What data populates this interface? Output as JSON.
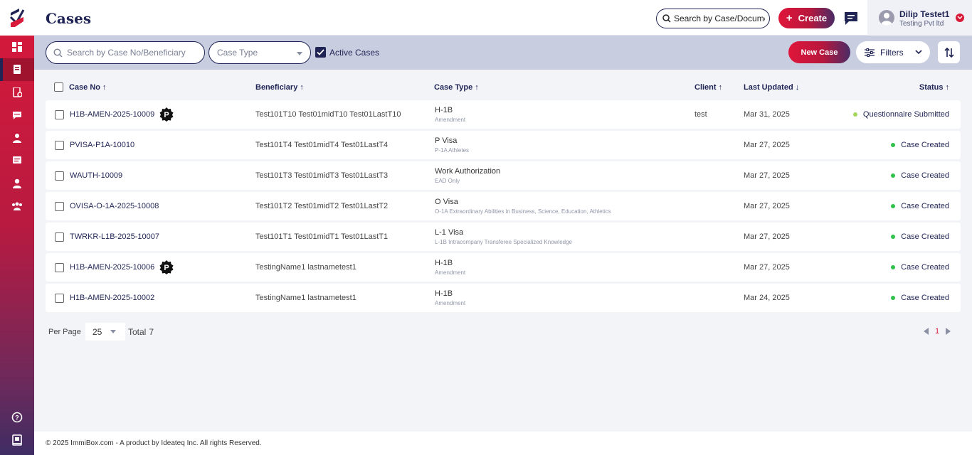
{
  "header": {
    "title": "Cases",
    "global_search_placeholder": "Search by Case/Document",
    "create_label": "Create",
    "user_name": "Dilip Testet1",
    "user_org": "Testing Pvt ltd"
  },
  "toolbar": {
    "search_placeholder": "Search by Case No/Beneficiary",
    "case_type_placeholder": "Case Type",
    "active_cases_label": "Active Cases",
    "active_cases_checked": true,
    "new_case_label": "New Case",
    "filters_label": "Filters"
  },
  "table": {
    "columns": [
      "Case No",
      "Beneficiary",
      "Case Type",
      "Client",
      "Last Updated",
      "Status"
    ],
    "rows": [
      {
        "case_no": "H1B-AMEN-2025-10009",
        "badge": "P",
        "beneficiary": "Test101T10 Test01midT10 Test01LastT10",
        "case_type": "H-1B",
        "case_subtype": "Amendment",
        "client": "test",
        "last_updated": "Mar 31, 2025",
        "status": "Questionnaire Submitted",
        "status_color": "#a4d65e"
      },
      {
        "case_no": "PVISA-P1A-10010",
        "badge": "",
        "beneficiary": "Test101T4 Test01midT4 Test01LastT4",
        "case_type": "P Visa",
        "case_subtype": "P-1A Athletes",
        "client": "",
        "last_updated": "Mar 27, 2025",
        "status": "Case Created",
        "status_color": "#2ec24a"
      },
      {
        "case_no": "WAUTH-10009",
        "badge": "",
        "beneficiary": "Test101T3 Test01midT3 Test01LastT3",
        "case_type": "Work Authorization",
        "case_subtype": "EAD Only",
        "client": "",
        "last_updated": "Mar 27, 2025",
        "status": "Case Created",
        "status_color": "#2ec24a"
      },
      {
        "case_no": "OVISA-O-1A-2025-10008",
        "badge": "",
        "beneficiary": "Test101T2 Test01midT2 Test01LastT2",
        "case_type": "O Visa",
        "case_subtype": "O-1A Extraordinary Abilities in Business, Science, Education, Athletics",
        "client": "",
        "last_updated": "Mar 27, 2025",
        "status": "Case Created",
        "status_color": "#2ec24a"
      },
      {
        "case_no": "TWRKR-L1B-2025-10007",
        "badge": "",
        "beneficiary": "Test101T1 Test01midT1 Test01LastT1",
        "case_type": "L-1 Visa",
        "case_subtype": "L-1B Intracompany Transferee Specialized Knowledge",
        "client": "",
        "last_updated": "Mar 27, 2025",
        "status": "Case Created",
        "status_color": "#2ec24a"
      },
      {
        "case_no": "H1B-AMEN-2025-10006",
        "badge": "P",
        "beneficiary": "TestingName1 lastnametest1",
        "case_type": "H-1B",
        "case_subtype": "Amendment",
        "client": "",
        "last_updated": "Mar 27, 2025",
        "status": "Case Created",
        "status_color": "#2ec24a"
      },
      {
        "case_no": "H1B-AMEN-2025-10002",
        "badge": "",
        "beneficiary": "TestingName1 lastnametest1",
        "case_type": "H-1B",
        "case_subtype": "Amendment",
        "client": "",
        "last_updated": "Mar 24, 2025",
        "status": "Case Created",
        "status_color": "#2ec24a"
      }
    ]
  },
  "pagination": {
    "per_page_label": "Per Page",
    "per_page_value": "25",
    "total_label": "Total",
    "total_value": "7",
    "current_page": "1"
  },
  "footer": {
    "text": "© 2025 ImmiBox.com - A product by Ideateq Inc. All rights Reserved."
  },
  "colors": {
    "brand_red": "#d8193a",
    "brand_navy": "#1f2454"
  },
  "sidebar": {
    "items": [
      "dashboard-icon",
      "cases-icon",
      "documents-icon",
      "messages-icon",
      "beneficiary-icon",
      "forms-icon",
      "user-icon",
      "team-icon"
    ],
    "bottom_items": [
      "help-icon",
      "book-icon"
    ]
  }
}
